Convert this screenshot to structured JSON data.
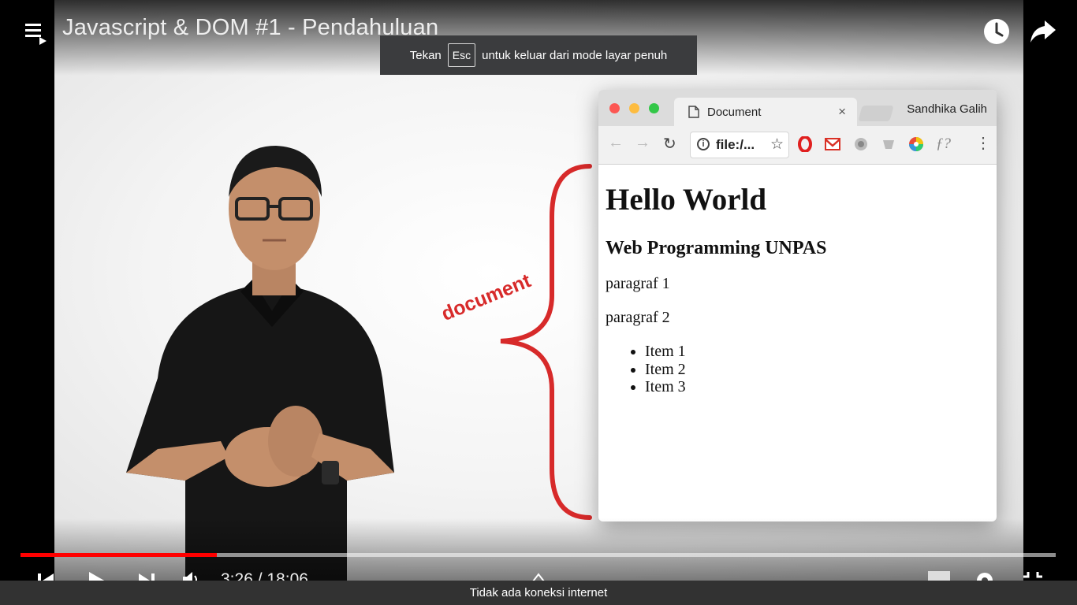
{
  "player": {
    "title": "Javascript & DOM #1 - Pendahuluan",
    "time_display": "3:26 / 18:06",
    "progress_fraction": 0.19
  },
  "fullscreen_notice": {
    "before": "Tekan",
    "key": "Esc",
    "after": "untuk keluar dari mode layar penuh"
  },
  "video_content": {
    "annotation_label": "document",
    "browser": {
      "tab_title": "Document",
      "tab_close": "×",
      "profile_name": "Sandhika Galih",
      "address_text": "file:/...",
      "page": {
        "heading": "Hello World",
        "subheading": "Web Programming UNPAS",
        "paragraphs": [
          "paragraf 1",
          "paragraf 2"
        ],
        "list_items": [
          "Item 1",
          "Item 2",
          "Item 3"
        ]
      }
    }
  },
  "status_bar": {
    "message": "Tidak ada koneksi internet"
  },
  "icons": [
    "playlist-icon",
    "watch-later-icon",
    "share-icon",
    "back-icon",
    "forward-icon",
    "reload-icon",
    "info-icon",
    "star-icon",
    "menu-icon",
    "skip-previous-icon",
    "play-icon",
    "skip-next-icon",
    "volume-icon",
    "miniplayer-icon",
    "settings-icon",
    "fullscreen-exit-icon"
  ],
  "colors": {
    "progress": "#ff0000",
    "annotation": "#d72a2a",
    "notice_bg": "#3b3c3e",
    "offline_bg": "#323232"
  }
}
